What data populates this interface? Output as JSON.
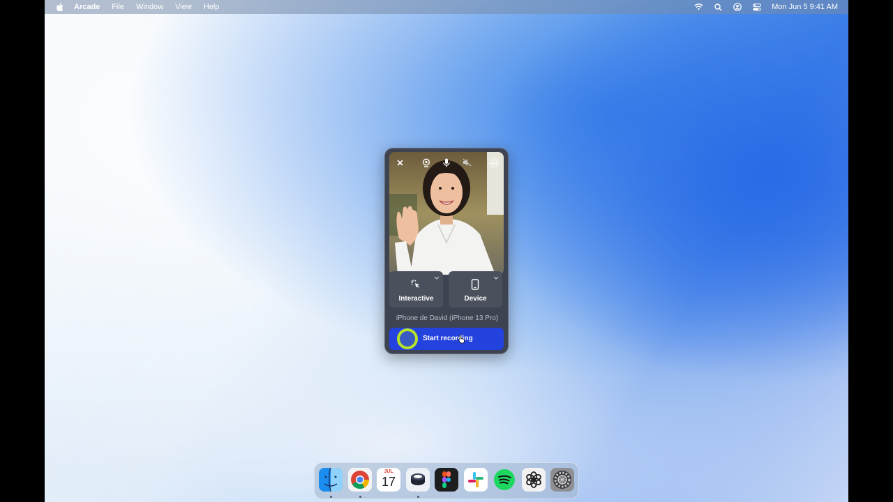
{
  "menubar": {
    "app_name": "Arcade",
    "items": [
      "File",
      "Window",
      "View",
      "Help"
    ],
    "clock": "Mon Jun 5  9:41 AM"
  },
  "recorder": {
    "modes": [
      {
        "label": "Interactive",
        "icon": "cursor-click-icon"
      },
      {
        "label": "Device",
        "icon": "phone-icon"
      }
    ],
    "device_name": "iPhone de David (iPhone 13 Pro)",
    "start_label": "Start recording"
  },
  "dock": {
    "calendar_month": "JUL",
    "calendar_day": "17",
    "apps": [
      "Finder",
      "Chrome",
      "Calendar",
      "Arcade",
      "Figma",
      "Slack",
      "Spotify",
      "ChatGPT",
      "System Settings"
    ]
  },
  "colors": {
    "accent_blue": "#2442dd",
    "ring_green": "#b6e22a",
    "widget_bg": "#3d4350"
  }
}
